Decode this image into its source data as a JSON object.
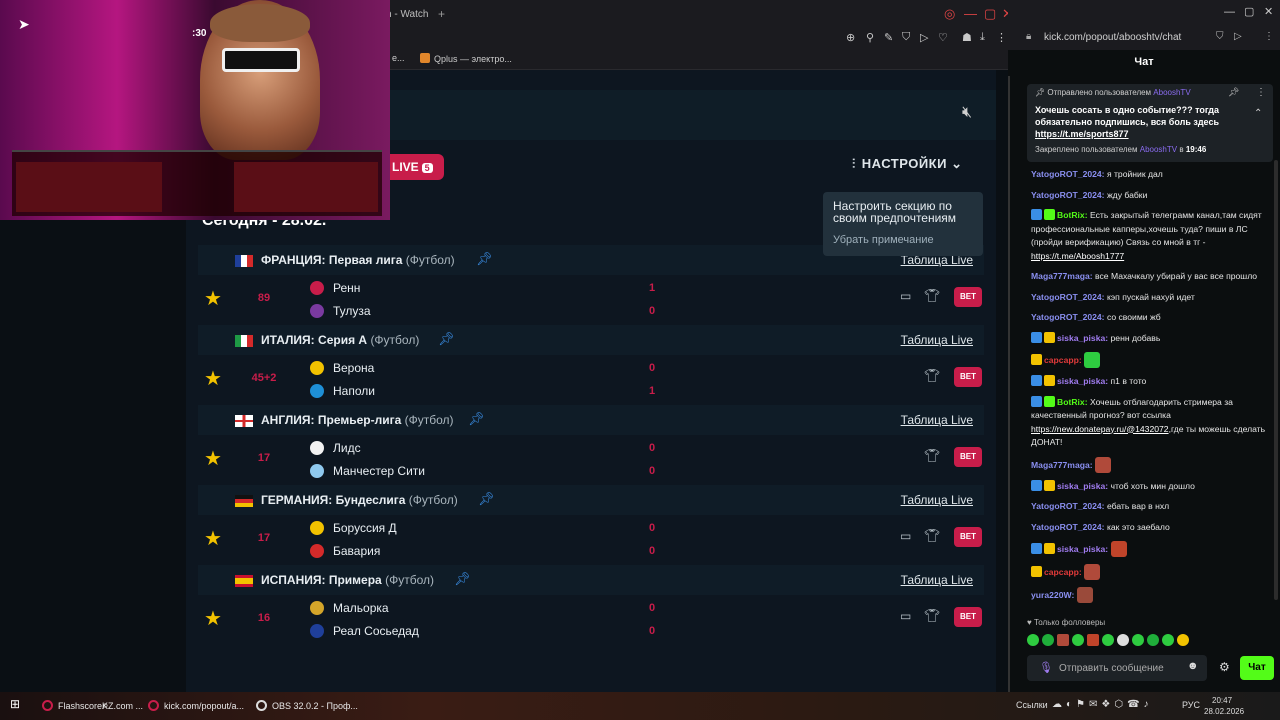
{
  "left_browser": {
    "tab_title": "n - Watch",
    "bookmarks": [
      "e...",
      "Qplus — электро..."
    ]
  },
  "site": {
    "live_label": "LIVE",
    "live_count": "5",
    "settings_label": "НАСТРОЙКИ",
    "today_label": "Сегодня - 28.02.",
    "tooltip": {
      "text": "Настроить секцию по своим предпочтениям",
      "dismiss": "Убрать примечание"
    },
    "table_link": "Таблица Live",
    "bet_label": "BET",
    "leagues": [
      {
        "country": "ФРАНЦИЯ:",
        "name": "Первая лига",
        "sport": "(Футбол)",
        "match": {
          "minute": "89",
          "home": "Ренн",
          "away": "Тулуза",
          "home_score": "1",
          "away_score": "0",
          "has_tv": true
        }
      },
      {
        "country": "ИТАЛИЯ:",
        "name": "Серия А",
        "sport": "(Футбол)",
        "match": {
          "minute": "45+2",
          "home": "Верона",
          "away": "Наполи",
          "home_score": "0",
          "away_score": "1",
          "has_tv": false
        }
      },
      {
        "country": "АНГЛИЯ:",
        "name": "Премьер-лига",
        "sport": "(Футбол)",
        "match": {
          "minute": "17",
          "home": "Лидс",
          "away": "Манчестер Сити",
          "home_score": "0",
          "away_score": "0",
          "has_tv": false
        }
      },
      {
        "country": "ГЕРМАНИЯ:",
        "name": "Бундеслига",
        "sport": "(Футбол)",
        "match": {
          "minute": "17",
          "home": "Боруссия Д",
          "away": "Бавария",
          "home_score": "0",
          "away_score": "0",
          "has_tv": true
        }
      },
      {
        "country": "ИСПАНИЯ:",
        "name": "Примера",
        "sport": "(Футбол)",
        "match": {
          "minute": "16",
          "home": "Мальорка",
          "away": "Реал Сосьедад",
          "home_score": "0",
          "away_score": "0",
          "has_tv": true
        }
      }
    ]
  },
  "stream": {
    "hud_timer": ":30"
  },
  "right_browser": {
    "url": "kick.com/popout/abooshtv/chat",
    "chat_title": "Чат",
    "pinned": {
      "sent_by_label": "Отправлено пользователем",
      "sent_by_user": "AbooshTV",
      "text": "Хочешь сосать в одно событие??? тогда обязательно подпишись, вся боль здесь",
      "link": "https://t.me/sports877",
      "pinned_by_label": "Закреплено пользователем",
      "pinned_by_user": "AbooshTV",
      "pinned_at_prefix": "в",
      "pinned_at": "19:46"
    },
    "messages": [
      {
        "user": "YatogoROT_2024:",
        "color": "#8a8ff0",
        "text": "я тройник дал"
      },
      {
        "user": "YatogoROT_2024:",
        "color": "#8a8ff0",
        "text": "жду бабки"
      },
      {
        "user": "BotRix:",
        "color": "#53fc18",
        "badges": [
          "#3a8ee6",
          "#53fc18"
        ],
        "text": "Есть закрытый телеграмм канал,там сидят профессиональные капперы,хочешь туда? пиши в ЛС (пройди верификацию) Связь со мной в тг -",
        "link": "https://t.me/Aboosh1777"
      },
      {
        "user": "Maga777maga:",
        "color": "#8a8ff0",
        "text": "все Махачкалу убирай у вас все прошло"
      },
      {
        "user": "YatogoROT_2024:",
        "color": "#8a8ff0",
        "text": "кэп пускай нахуй идет"
      },
      {
        "user": "YatogoROT_2024:",
        "color": "#8a8ff0",
        "text": "со своими жб"
      },
      {
        "user": "siska_piska:",
        "color": "#a07cf0",
        "badges": [
          "#3a8ee6",
          "#f2c200"
        ],
        "text": "ренн добавь"
      },
      {
        "user": "capcapp:",
        "color": "#e03a3a",
        "badges": [
          "#f2c200"
        ],
        "text": "",
        "emote": true,
        "emote_color": "#2ecc40"
      },
      {
        "user": "siska_piska:",
        "color": "#a07cf0",
        "badges": [
          "#3a8ee6",
          "#f2c200"
        ],
        "text": "п1 в тото"
      },
      {
        "user": "BotRix:",
        "color": "#53fc18",
        "badges": [
          "#3a8ee6",
          "#53fc18"
        ],
        "text": "Хочешь отблагодарить стримера за качественный прогноз? вот ссылка",
        "link": "https://new.donatepay.ru/@1432072",
        "text_after": ",где ты можешь сделать ДОНАТ!"
      },
      {
        "user": "Maga777maga:",
        "color": "#8a8ff0",
        "text": "",
        "emote": true,
        "emote_color": "#b04a3a"
      },
      {
        "user": "siska_piska:",
        "color": "#a07cf0",
        "badges": [
          "#3a8ee6",
          "#f2c200"
        ],
        "text": "чтоб хоть мин дошло"
      },
      {
        "user": "YatogoROT_2024:",
        "color": "#8a8ff0",
        "text": "ебать вар в нхл"
      },
      {
        "user": "YatogoROT_2024:",
        "color": "#8a8ff0",
        "text": "как это заебало"
      },
      {
        "user": "siska_piska:",
        "color": "#a07cf0",
        "badges": [
          "#3a8ee6",
          "#f2c200"
        ],
        "text": "",
        "emote": true,
        "emote_color": "#c0442a"
      },
      {
        "user": "capcapp:",
        "color": "#e03a3a",
        "badges": [
          "#f2c200"
        ],
        "text": "",
        "emote": true,
        "emote_color": "#b04a3a"
      },
      {
        "user": "yura220W:",
        "color": "#8a8ff0",
        "text": "",
        "emote": true,
        "emote_color": "#9a4a3a"
      }
    ],
    "followers_only": "Только фолловеры",
    "input_placeholder": "Отправить сообщение",
    "send_label": "Чат"
  },
  "taskbar": {
    "items": [
      "FlashscoreKZ.com ...",
      "kick.com/popout/a...",
      "OBS 32.0.2 - Проф..."
    ],
    "tray_label": "Ссылки",
    "language": "РУС",
    "time": "20:47",
    "date": "28.02.2026"
  },
  "colors": {
    "accent_live": "#c81d4a",
    "kick_green": "#53fc18",
    "star": "#f2c200"
  }
}
